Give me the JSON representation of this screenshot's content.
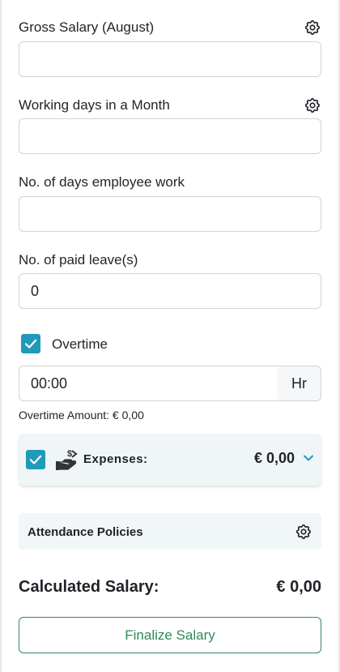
{
  "gross_salary": {
    "label": "Gross Salary (August)",
    "value": ""
  },
  "working_days": {
    "label": "Working days in a Month",
    "value": ""
  },
  "days_worked": {
    "label": "No. of days employee work",
    "value": ""
  },
  "paid_leave": {
    "label": "No. of paid leave(s)",
    "value": "0"
  },
  "overtime": {
    "label": "Overtime",
    "checked": true,
    "time_value": "00:00",
    "unit": "Hr",
    "amount_text": "Overtime Amount: € 0,00"
  },
  "expenses": {
    "checked": true,
    "label": "Expenses:",
    "amount": "€ 0,00"
  },
  "attendance_policies": {
    "label": "Attendance Policies"
  },
  "calculated_salary": {
    "label": "Calculated Salary:",
    "amount": "€ 0,00"
  },
  "finalize_button": {
    "label": "Finalize Salary"
  },
  "colors": {
    "accent": "#1f9bb8",
    "finalize": "#2e8b57",
    "panel_bg": "#f1f6f8"
  }
}
